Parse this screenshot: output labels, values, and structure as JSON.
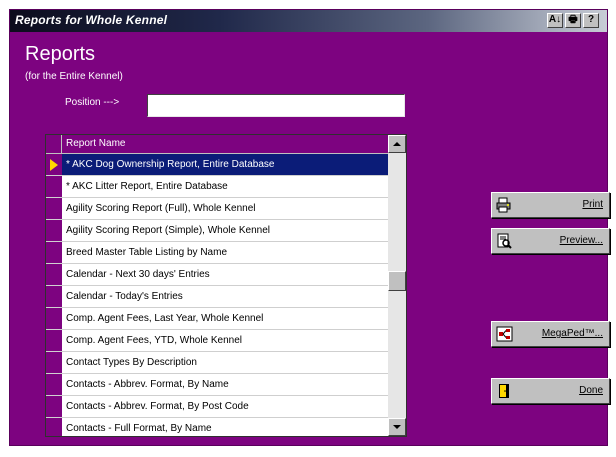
{
  "window": {
    "title": "Reports for Whole Kennel"
  },
  "titlebar_buttons": [
    {
      "name": "sort",
      "label": "A↓"
    },
    {
      "name": "print",
      "label": "🖶"
    },
    {
      "name": "help",
      "label": "?"
    }
  ],
  "header": {
    "title": "Reports",
    "subtitle": "(for the Entire Kennel)"
  },
  "position": {
    "label": "Position --->",
    "value": ""
  },
  "grid": {
    "column_header": "Report Name",
    "rows": [
      "* AKC Dog Ownership Report, Entire Database",
      "* AKC Litter Report, Entire Database",
      "Agility Scoring Report (Full), Whole Kennel",
      "Agility Scoring Report (Simple), Whole Kennel",
      "Breed Master Table Listing by Name",
      "Calendar - Next 30 days' Entries",
      "Calendar - Today's Entries",
      "Comp. Agent Fees, Last Year, Whole Kennel",
      "Comp. Agent Fees, YTD, Whole Kennel",
      "Contact Types By Description",
      "Contacts - Abbrev. Format, By Name",
      "Contacts - Abbrev. Format, By Post Code",
      "Contacts - Full Format, By Name"
    ],
    "selected_index": 0
  },
  "buttons": {
    "print": "Print",
    "preview": "Preview...",
    "megaped": "MegaPed™...",
    "done": "Done"
  },
  "colors": {
    "background": "#7d0380",
    "selection": "#0b1c78",
    "button_face": "#c0c0c0"
  }
}
